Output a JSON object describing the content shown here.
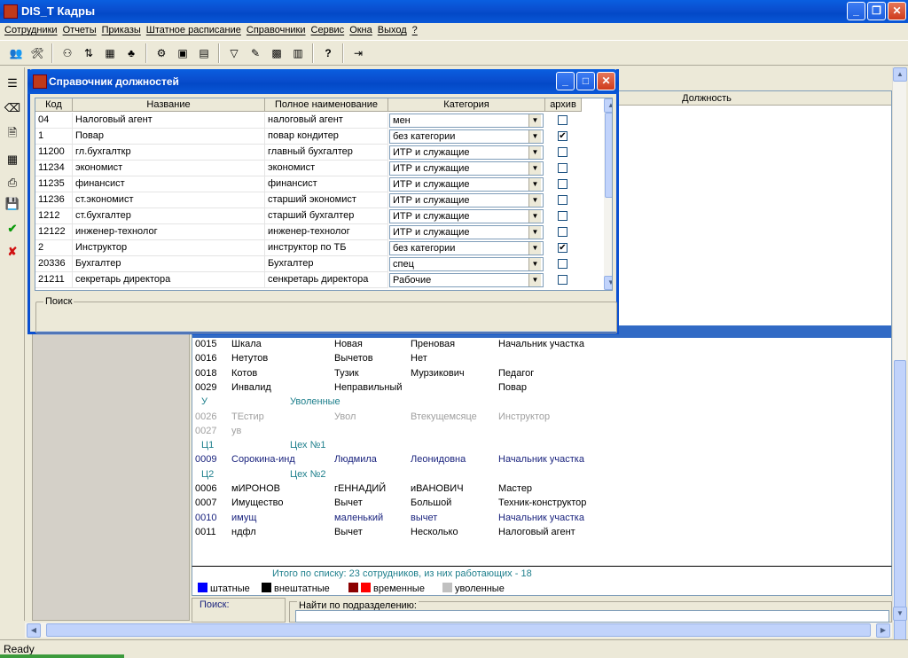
{
  "app": {
    "title": "DIS_T Кадры",
    "status": "Ready"
  },
  "menu": [
    "Сотрудники",
    "Отчеты",
    "Приказы",
    "Штатное расписание",
    "Справочники",
    "Сервис",
    "Окна",
    "Выход",
    "?"
  ],
  "toolbar_icons": [
    "people-icon",
    "tools-icon",
    "group-icon",
    "swap-icon",
    "calendar-icon",
    "tree-icon",
    "org-icon",
    "card-icon",
    "table-icon",
    "filter-icon",
    "edit-icon",
    "sheet-icon",
    "grid-icon",
    "help-icon",
    "exit-icon"
  ],
  "left_toolbar_icons": [
    "tree-list-icon",
    "eraser-icon",
    "document-icon",
    "calculator-icon",
    "print-icon",
    "save-icon",
    "check-icon",
    "cancel-icon"
  ],
  "background": {
    "column_header": "Должность",
    "rows": [
      {
        "type": "emp",
        "code": "0015",
        "last": "Шкала",
        "first": "Новая",
        "middle": "Преновая",
        "position": "Начальник участка",
        "style": "black"
      },
      {
        "type": "emp",
        "code": "0016",
        "last": "Нетутов",
        "first": "Вычетов",
        "middle": "Нет",
        "position": "",
        "style": "black"
      },
      {
        "type": "emp",
        "code": "0018",
        "last": "Котов",
        "first": "Тузик",
        "middle": "Мурзикович",
        "position": "Педагог",
        "style": "black"
      },
      {
        "type": "emp",
        "code": "0029",
        "last": "Инвалид",
        "first": "Неправильный",
        "middle": "",
        "position": "Повар",
        "style": "black"
      },
      {
        "type": "grp",
        "code": "У",
        "name": "Уволенные"
      },
      {
        "type": "emp",
        "code": "0026",
        "last": "ТЕстир",
        "first": "Увол",
        "middle": "Втекущемсяце",
        "position": "Инструктор",
        "style": "fired"
      },
      {
        "type": "emp",
        "code": "0027",
        "last": "ув",
        "first": "",
        "middle": "",
        "position": "",
        "style": "fired"
      },
      {
        "type": "grp",
        "code": "Ц1",
        "name": "Цех №1"
      },
      {
        "type": "emp",
        "code": "0009",
        "last": "Сорокина-инд",
        "first": "Людмила",
        "middle": "Леонидовна",
        "position": "Начальник участка",
        "style": "navy"
      },
      {
        "type": "grp",
        "code": "Ц2",
        "name": "Цех №2"
      },
      {
        "type": "emp",
        "code": "0006",
        "last": "мИРОНОВ",
        "first": "гЕННАДИЙ",
        "middle": "иВАНОВИЧ",
        "position": "Мастер",
        "style": "black"
      },
      {
        "type": "emp",
        "code": "0007",
        "last": "Имущество",
        "first": "Вычет",
        "middle": "Большой",
        "position": "Техник-конструктор",
        "style": "black"
      },
      {
        "type": "emp",
        "code": "0010",
        "last": "имущ",
        "first": "маленький",
        "middle": "вычет",
        "position": "Начальник участка",
        "style": "navy"
      },
      {
        "type": "emp",
        "code": "0011",
        "last": "ндфл",
        "first": "Вычет",
        "middle": "Несколько",
        "position": "Налоговый агент",
        "style": "black"
      }
    ],
    "total": "Итого по списку: 23 сотрудников, из них работающих - 18",
    "legend": [
      {
        "label": "штатные",
        "colors": [
          "#0000ff"
        ]
      },
      {
        "label": "внештатные",
        "colors": [
          "#000000"
        ]
      },
      {
        "label": "временные",
        "colors": [
          "#8b0000",
          "#ff0000"
        ]
      },
      {
        "label": "уволенные",
        "colors": [
          "#c0c0c0"
        ]
      }
    ],
    "search_label": "Поиск:",
    "dept_search_label": "Найти по подразделению:"
  },
  "dialog": {
    "title": "Справочник должностей",
    "columns": [
      "Код",
      "Название",
      "Полное наименование",
      "Категория",
      "архив"
    ],
    "rows": [
      {
        "code": "04",
        "name": "Налоговый агент",
        "full": "налоговый агент",
        "category": "мен",
        "archived": false
      },
      {
        "code": "1",
        "name": "Повар",
        "full": "повар кондитер",
        "category": "без категории",
        "archived": true
      },
      {
        "code": "11200",
        "name": "гл.бухгалткр",
        "full": "главный бухгалтер",
        "category": "ИТР и служащие",
        "archived": false
      },
      {
        "code": "11234",
        "name": "экономист",
        "full": "экономист",
        "category": "ИТР и служащие",
        "archived": false
      },
      {
        "code": "11235",
        "name": "финансист",
        "full": "финансист",
        "category": "ИТР и служащие",
        "archived": false
      },
      {
        "code": "11236",
        "name": "ст.экономист",
        "full": "старший экономист",
        "category": "ИТР и служащие",
        "archived": false
      },
      {
        "code": "1212",
        "name": "ст.бухгалтер",
        "full": "старший бухгалтер",
        "category": "ИТР и служащие",
        "archived": false
      },
      {
        "code": "12122",
        "name": "инженер-технолог",
        "full": "инженер-технолог",
        "category": "ИТР и служащие",
        "archived": false
      },
      {
        "code": "2",
        "name": "Инструктор",
        "full": "инструктор по ТБ",
        "category": "без категории",
        "archived": true
      },
      {
        "code": "20336",
        "name": "Бухгалтер",
        "full": "Бухгалтер",
        "category": "спец",
        "archived": false
      },
      {
        "code": "21211",
        "name": "секретарь директора",
        "full": "сенкретарь директора",
        "category": "Рабочие",
        "archived": false
      }
    ],
    "search_label": "Поиск"
  }
}
